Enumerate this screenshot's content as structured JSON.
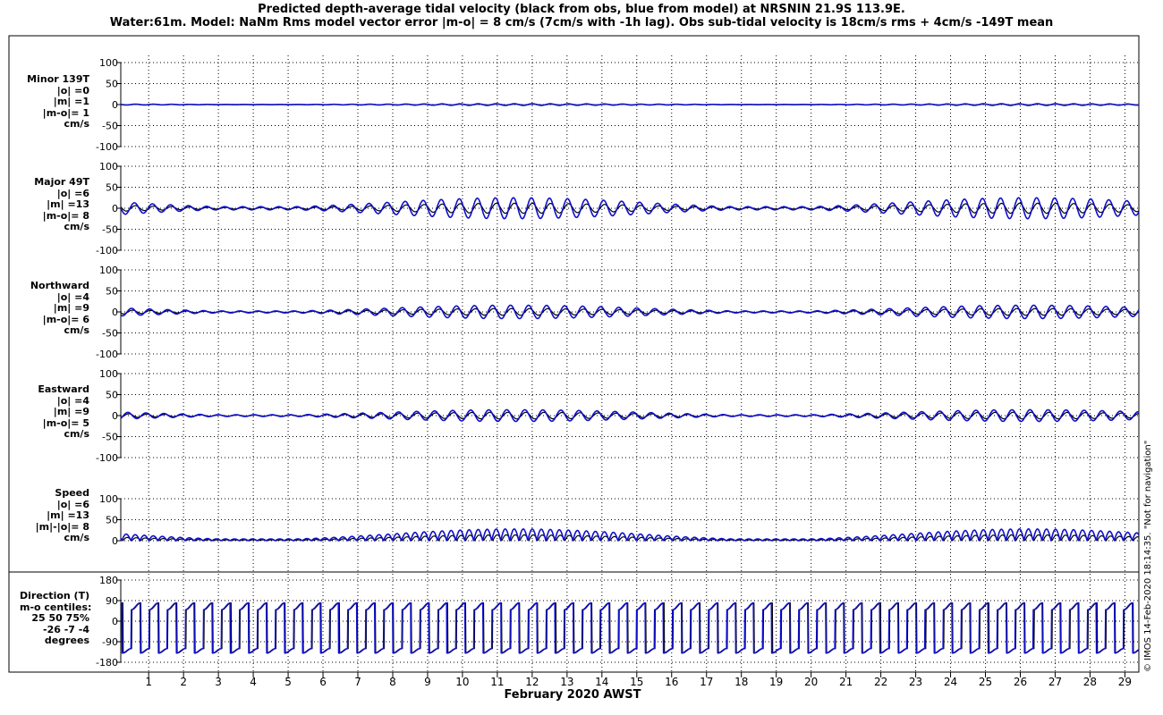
{
  "header": {
    "title_line1": "Predicted depth-average tidal velocity (black from obs, blue from model) at NRSNIN 21.9S 113.9E.",
    "title_line2": "Water:61m. Model: NaNm  Rms model vector error |m-o| = 8 cm/s (7cm/s with -1h lag). Obs sub-tidal velocity is 18cm/s rms + 4cm/s -149T mean"
  },
  "footer": "© IMOS 14-Feb-2020 18:14:35. \"Not for navigation\"",
  "colors": {
    "obs": "#000000",
    "model": "#1010cc",
    "grid": "#000000",
    "background": "#ffffff"
  },
  "chart_data": [
    {
      "type": "line",
      "label": [
        "Minor 139T",
        "|o| =0",
        "|m| =1",
        "|m-o|= 1",
        "cm/s"
      ],
      "yticks": [
        "100",
        "50",
        "0",
        "-50",
        "-100"
      ],
      "ylim": [
        -100,
        100
      ],
      "series": [
        {
          "name": "black from obs",
          "amplitude_max_cm_s": 1,
          "mean_cm_s": 0
        },
        {
          "name": "blue from model",
          "amplitude_max_cm_s": 2,
          "mean_cm_s": 0
        }
      ]
    },
    {
      "type": "line",
      "label": [
        "Major 49T",
        "|o| =6",
        "|m| =13",
        "|m-o|= 8",
        "cm/s"
      ],
      "yticks": [
        "100",
        "50",
        "0",
        "-50",
        "-100"
      ],
      "ylim": [
        -100,
        100
      ],
      "series": [
        {
          "name": "black from obs",
          "amplitude_max_cm_s": 12,
          "mean_cm_s": 0
        },
        {
          "name": "blue from model",
          "amplitude_max_cm_s": 25,
          "mean_cm_s": 0
        }
      ]
    },
    {
      "type": "line",
      "label": [
        "Northward",
        "|o| =4",
        "|m| =9",
        "|m-o|= 6",
        "cm/s"
      ],
      "yticks": [
        "100",
        "50",
        "0",
        "-50",
        "-100"
      ],
      "ylim": [
        -100,
        100
      ],
      "series": [
        {
          "name": "black from obs",
          "amplitude_max_cm_s": 8,
          "mean_cm_s": 0
        },
        {
          "name": "blue from model",
          "amplitude_max_cm_s": 16,
          "mean_cm_s": 0
        }
      ]
    },
    {
      "type": "line",
      "label": [
        "Eastward",
        "|o| =4",
        "|m| =9",
        "|m-o|= 5",
        "cm/s"
      ],
      "yticks": [
        "100",
        "50",
        "0",
        "-50",
        "-100"
      ],
      "ylim": [
        -100,
        100
      ],
      "series": [
        {
          "name": "black from obs",
          "amplitude_max_cm_s": 8,
          "mean_cm_s": 0
        },
        {
          "name": "blue from model",
          "amplitude_max_cm_s": 14,
          "mean_cm_s": 0
        }
      ]
    },
    {
      "type": "line",
      "label": [
        "Speed",
        "|o| =6",
        "|m| =13",
        "|m|-|o|= 8",
        "cm/s"
      ],
      "yticks": [
        "100",
        "50",
        "0"
      ],
      "ylim": [
        0,
        100
      ],
      "series": [
        {
          "name": "black from obs",
          "amplitude_max_cm_s": 14,
          "mean_cm_s": 6
        },
        {
          "name": "blue from model",
          "amplitude_max_cm_s": 28,
          "mean_cm_s": 13
        }
      ]
    },
    {
      "type": "line",
      "label": [
        "Direction (T)",
        "m-o centiles:",
        "25  50  75%",
        "-26  -7  -4",
        "degrees"
      ],
      "yticks": [
        "180",
        "90",
        "0",
        "-90",
        "-180"
      ],
      "ylim": [
        -180,
        180
      ],
      "series": [
        {
          "name": "black from obs",
          "high_deg": 65,
          "low_deg": -130
        },
        {
          "name": "blue from model",
          "high_deg": 65,
          "low_deg": -130
        }
      ]
    }
  ],
  "x_axis": {
    "title": "February 2020 AWST",
    "ticks": [
      "1",
      "2",
      "3",
      "4",
      "5",
      "6",
      "7",
      "8",
      "9",
      "10",
      "11",
      "12",
      "13",
      "14",
      "15",
      "16",
      "17",
      "18",
      "19",
      "20",
      "21",
      "22",
      "23",
      "24",
      "25",
      "26",
      "27",
      "28",
      "29"
    ],
    "range_days": [
      0.2,
      29.4
    ],
    "grid": true
  }
}
